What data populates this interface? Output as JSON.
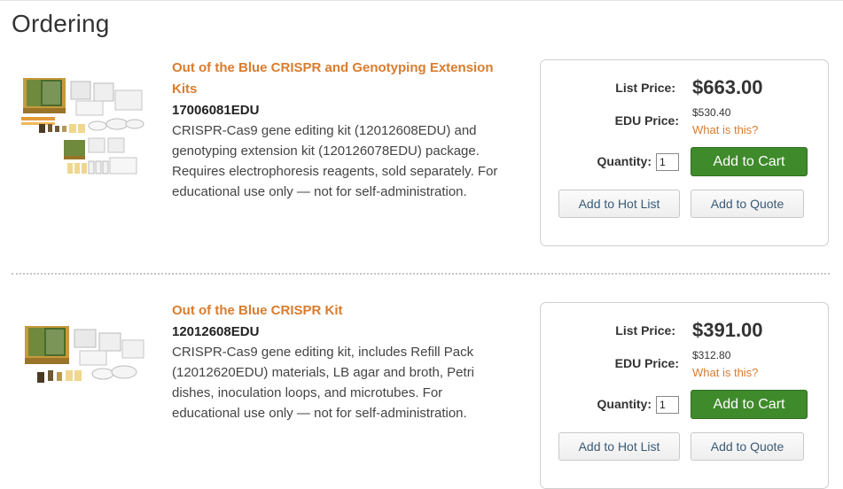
{
  "page": {
    "title": "Ordering"
  },
  "products": [
    {
      "title": "Out of the Blue CRISPR and Genotyping Extension Kits",
      "sku": "17006081EDU",
      "description": "CRISPR-Cas9 gene editing kit (12012608EDU) and genotyping extension kit (120126078EDU) package. Requires electrophoresis reagents, sold separately. For educational use only — not for self-administration.",
      "list_price_label": "List Price:",
      "list_price": "$663.00",
      "edu_price_label": "EDU Price:",
      "edu_price": "$530.40",
      "what_is_this": "What is this?",
      "quantity_label": "Quantity:",
      "quantity": "1",
      "add_to_cart": "Add to Cart",
      "add_to_hot_list": "Add to Hot List",
      "add_to_quote": "Add to Quote"
    },
    {
      "title": "Out of the Blue CRISPR Kit",
      "sku": "12012608EDU",
      "description": "CRISPR-Cas9 gene editing kit, includes Refill Pack (12012620EDU) materials, LB agar and broth, Petri dishes, inoculation loops, and microtubes. For educational use only — not for self-administration.",
      "list_price_label": "List Price:",
      "list_price": "$391.00",
      "edu_price_label": "EDU Price:",
      "edu_price": "$312.80",
      "what_is_this": "What is this?",
      "quantity_label": "Quantity:",
      "quantity": "1",
      "add_to_cart": "Add to Cart",
      "add_to_hot_list": "Add to Hot List",
      "add_to_quote": "Add to Quote"
    }
  ],
  "colors": {
    "link_orange": "#d97c2e",
    "cart_green": "#3f8a2b",
    "secondary_text": "#3a5a75"
  }
}
